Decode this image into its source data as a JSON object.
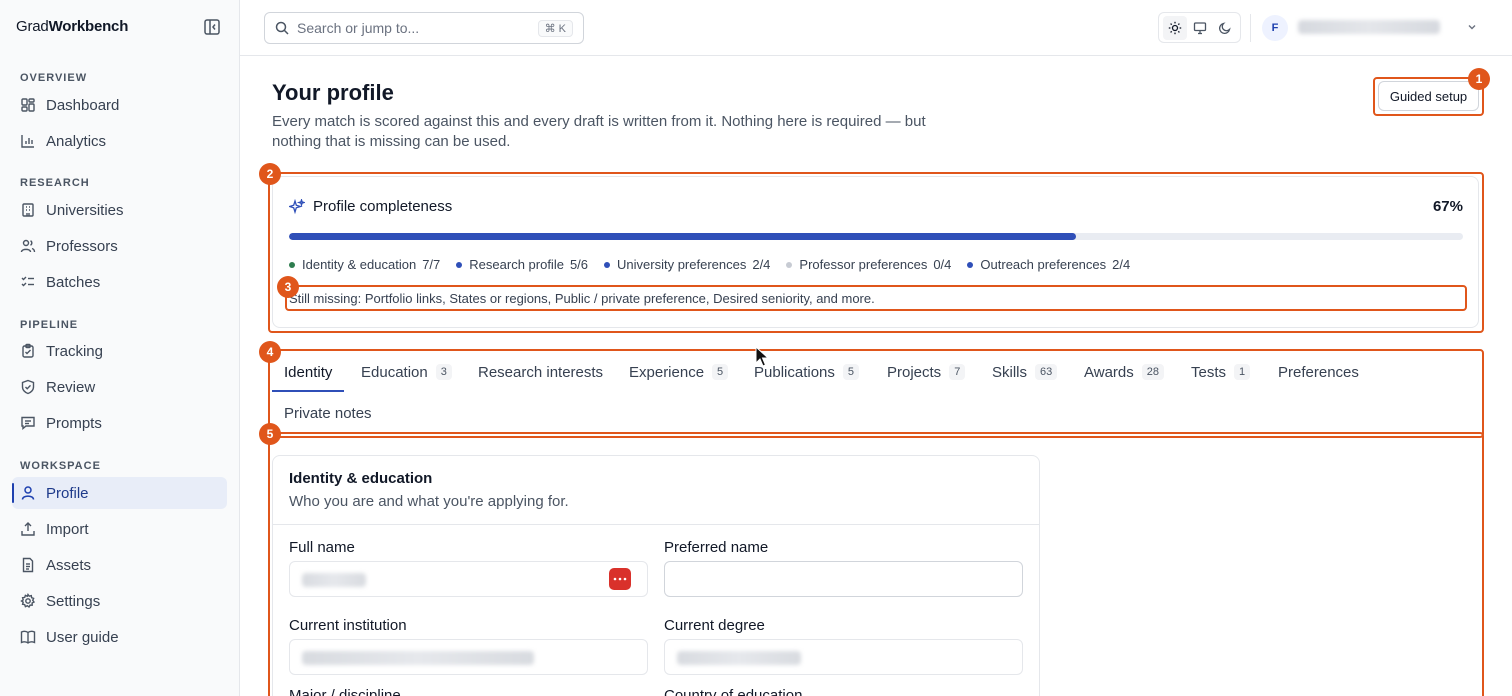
{
  "brand": {
    "part1": "Grad",
    "part2": "Workbench"
  },
  "sidebar": {
    "sections": [
      {
        "label": "OVERVIEW",
        "items": [
          {
            "label": "Dashboard",
            "icon": "dashboard-icon"
          },
          {
            "label": "Analytics",
            "icon": "chart-icon"
          }
        ]
      },
      {
        "label": "RESEARCH",
        "items": [
          {
            "label": "Universities",
            "icon": "building-icon"
          },
          {
            "label": "Professors",
            "icon": "users-icon"
          },
          {
            "label": "Batches",
            "icon": "list-checks-icon"
          }
        ]
      },
      {
        "label": "PIPELINE",
        "items": [
          {
            "label": "Tracking",
            "icon": "clipboard-icon"
          },
          {
            "label": "Review",
            "icon": "shield-check-icon"
          },
          {
            "label": "Prompts",
            "icon": "message-icon"
          }
        ]
      },
      {
        "label": "WORKSPACE",
        "items": [
          {
            "label": "Profile",
            "icon": "user-icon",
            "active": true
          },
          {
            "label": "Import",
            "icon": "upload-icon"
          },
          {
            "label": "Assets",
            "icon": "file-icon"
          },
          {
            "label": "Settings",
            "icon": "gear-icon"
          },
          {
            "label": "User guide",
            "icon": "book-icon"
          }
        ]
      }
    ]
  },
  "topbar": {
    "search_placeholder": "Search or jump to...",
    "search_shortcut": "⌘ K",
    "avatar_initial": "F",
    "theme_active": "light"
  },
  "page": {
    "title": "Your profile",
    "subtitle": "Every match is scored against this and every draft is written from it. Nothing here is required — but nothing that is missing can be used.",
    "guided_setup_label": "Guided setup"
  },
  "completeness": {
    "title": "Profile completeness",
    "percent_label": "67%",
    "percent": 67,
    "categories": [
      {
        "label": "Identity & education",
        "count": "7/7",
        "color": "#2e7d4f"
      },
      {
        "label": "Research profile",
        "count": "5/6",
        "color": "#2f4fb8"
      },
      {
        "label": "University preferences",
        "count": "2/4",
        "color": "#2f4fb8"
      },
      {
        "label": "Professor preferences",
        "count": "0/4",
        "color": "#c7cbd3"
      },
      {
        "label": "Outreach preferences",
        "count": "2/4",
        "color": "#2f4fb8"
      }
    ],
    "missing": "Still missing: Portfolio links, States or regions, Public / private preference, Desired seniority, and more."
  },
  "tabs": [
    {
      "label": "Identity",
      "badge": "",
      "active": true
    },
    {
      "label": "Education",
      "badge": "3"
    },
    {
      "label": "Research interests",
      "badge": ""
    },
    {
      "label": "Experience",
      "badge": "5"
    },
    {
      "label": "Publications",
      "badge": "5"
    },
    {
      "label": "Projects",
      "badge": "7"
    },
    {
      "label": "Skills",
      "badge": "63"
    },
    {
      "label": "Awards",
      "badge": "28"
    },
    {
      "label": "Tests",
      "badge": "1"
    },
    {
      "label": "Preferences",
      "badge": ""
    },
    {
      "label": "Private notes",
      "badge": ""
    }
  ],
  "identity_card": {
    "title": "Identity & education",
    "subtitle": "Who you are and what you're applying for.",
    "fields": {
      "full_name": "Full name",
      "preferred_name": "Preferred name",
      "current_institution": "Current institution",
      "current_degree": "Current degree",
      "major": "Major / discipline",
      "country": "Country of education"
    }
  },
  "markers": [
    "1",
    "2",
    "3",
    "4",
    "5"
  ],
  "colors": {
    "accent": "#2f4fb8",
    "highlight": "#e0561b",
    "danger": "#d9312b"
  }
}
